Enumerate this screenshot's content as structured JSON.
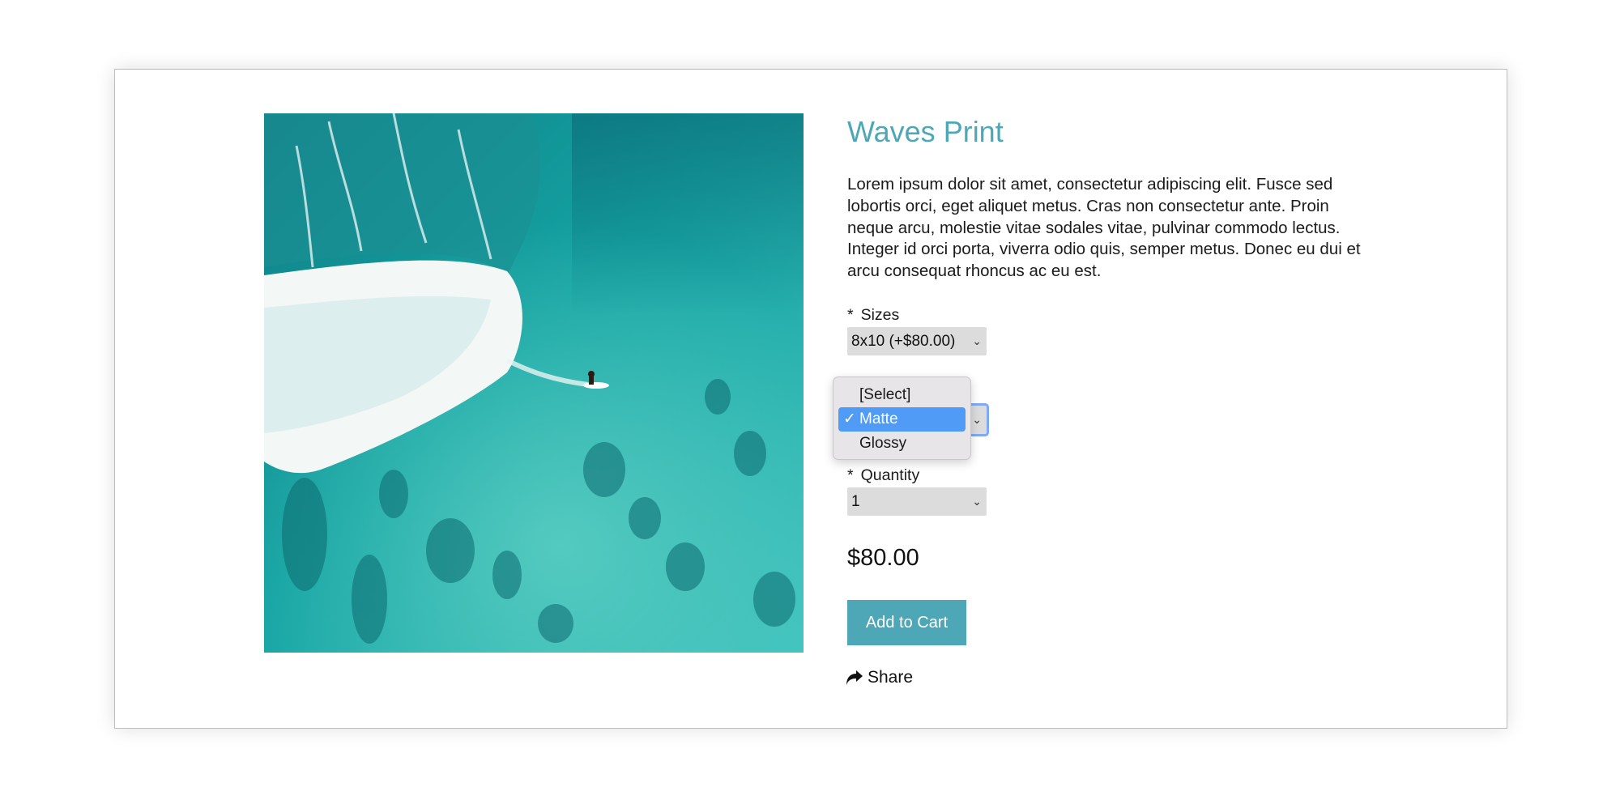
{
  "product": {
    "title": "Waves Print",
    "description": "Lorem ipsum dolor sit amet, consectetur adipiscing elit. Fusce sed lobortis orci, eget aliquet metus. Cras non consectetur ante. Proin neque arcu, molestie vitae sodales vitae, pulvinar commodo lectus. Integer id orci porta, viverra odio quis, semper metus. Donec eu dui et arcu consequat rhoncus ac eu est.",
    "price": "$80.00"
  },
  "fields": {
    "required_mark": "*",
    "sizes": {
      "label": "Sizes",
      "value": "8x10 (+$80.00)"
    },
    "finish": {
      "options": [
        {
          "label": "[Select]",
          "selected": false
        },
        {
          "label": "Matte",
          "selected": true
        },
        {
          "label": "Glossy",
          "selected": false
        }
      ],
      "check_mark": "✓"
    },
    "quantity": {
      "label": "Quantity",
      "value": "1"
    }
  },
  "actions": {
    "add_to_cart": "Add to Cart",
    "share": "Share"
  },
  "icons": {
    "chevron": "chevron-down-icon",
    "share": "share-arrow-icon"
  },
  "colors": {
    "accent": "#4ea7b6",
    "dropdown_highlight": "#4f9bf6",
    "focus_ring": "#7ea9f6"
  }
}
